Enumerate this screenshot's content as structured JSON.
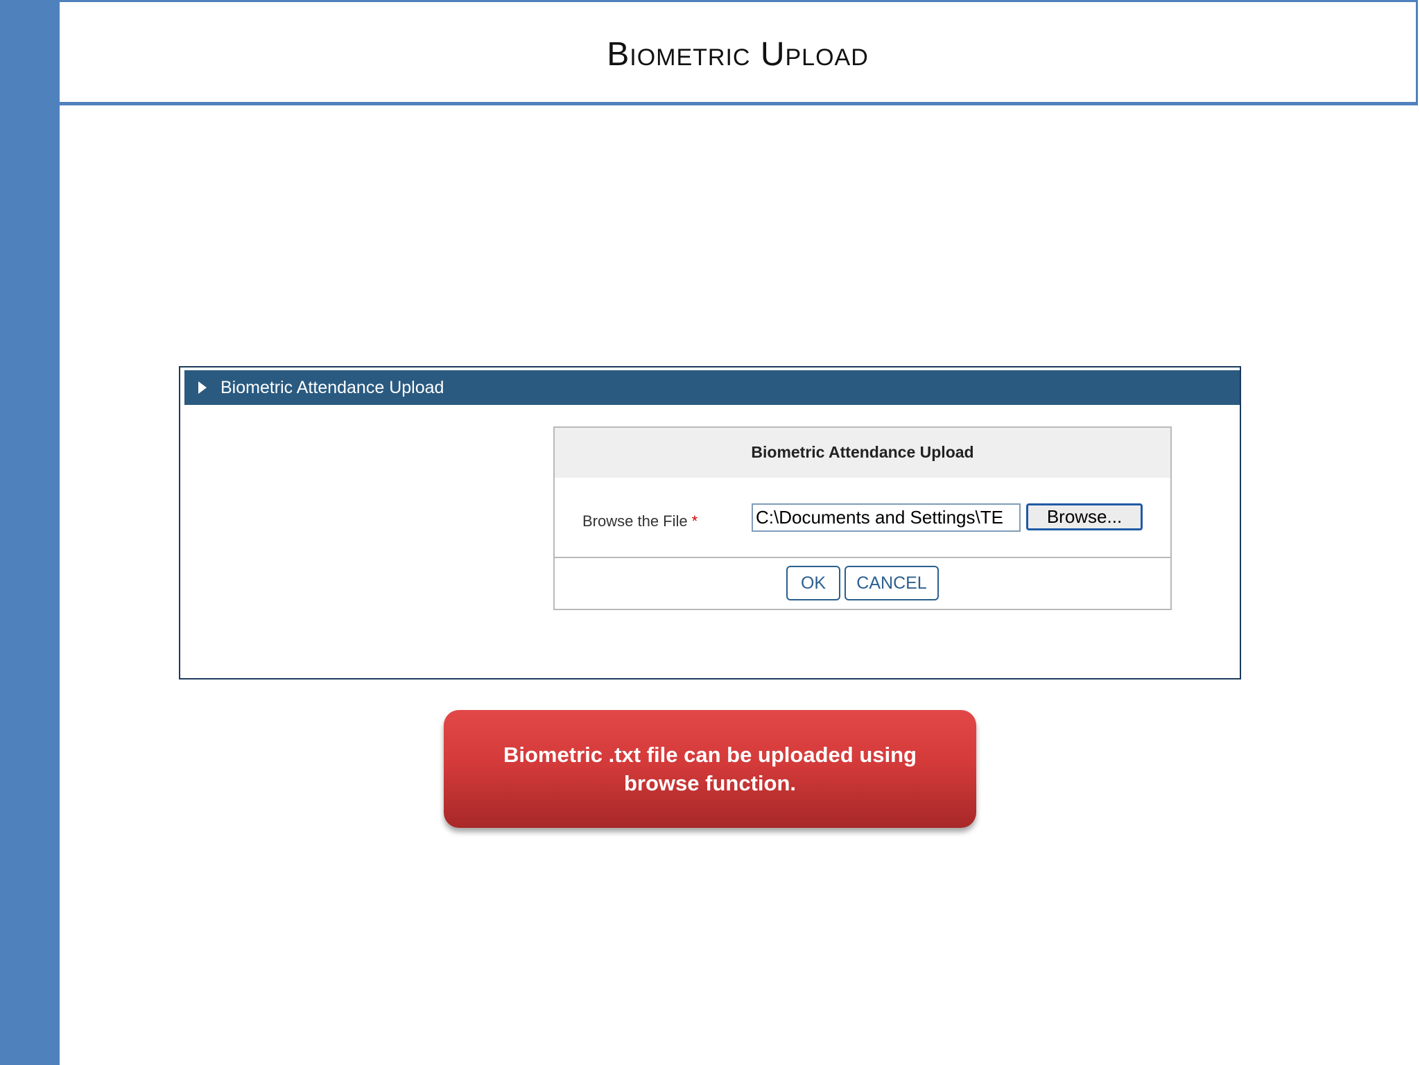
{
  "slide": {
    "title": "Biometric Upload"
  },
  "panel": {
    "header_title": "Biometric Attendance Upload",
    "form": {
      "heading": "Biometric Attendance Upload",
      "file_label": "Browse the File",
      "required_marker": "*",
      "file_value": "C:\\Documents and Settings\\TE",
      "browse_label": "Browse...",
      "ok_label": "OK",
      "cancel_label": "CANCEL"
    }
  },
  "callout": {
    "text": "Biometric .txt file can be uploaded using browse function."
  },
  "colors": {
    "accent": "#4f81bd",
    "panel_header": "#2a5a80",
    "callout": "#d43a3a"
  },
  "icons": {
    "panel_toggle": "triangle-right-icon"
  }
}
